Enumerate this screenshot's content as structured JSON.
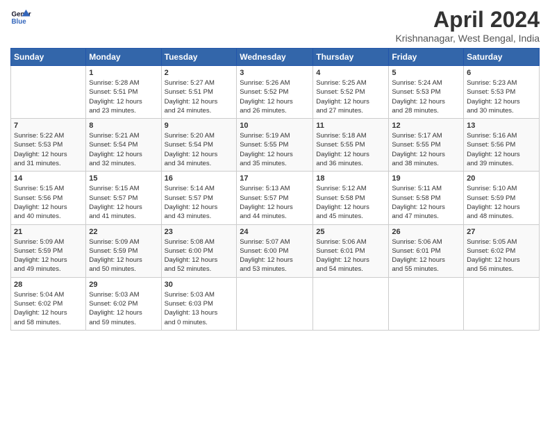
{
  "header": {
    "logo_line1": "General",
    "logo_line2": "Blue",
    "title": "April 2024",
    "location": "Krishnanagar, West Bengal, India"
  },
  "days_of_week": [
    "Sunday",
    "Monday",
    "Tuesday",
    "Wednesday",
    "Thursday",
    "Friday",
    "Saturday"
  ],
  "weeks": [
    [
      {
        "num": "",
        "info": ""
      },
      {
        "num": "1",
        "info": "Sunrise: 5:28 AM\nSunset: 5:51 PM\nDaylight: 12 hours\nand 23 minutes."
      },
      {
        "num": "2",
        "info": "Sunrise: 5:27 AM\nSunset: 5:51 PM\nDaylight: 12 hours\nand 24 minutes."
      },
      {
        "num": "3",
        "info": "Sunrise: 5:26 AM\nSunset: 5:52 PM\nDaylight: 12 hours\nand 26 minutes."
      },
      {
        "num": "4",
        "info": "Sunrise: 5:25 AM\nSunset: 5:52 PM\nDaylight: 12 hours\nand 27 minutes."
      },
      {
        "num": "5",
        "info": "Sunrise: 5:24 AM\nSunset: 5:53 PM\nDaylight: 12 hours\nand 28 minutes."
      },
      {
        "num": "6",
        "info": "Sunrise: 5:23 AM\nSunset: 5:53 PM\nDaylight: 12 hours\nand 30 minutes."
      }
    ],
    [
      {
        "num": "7",
        "info": "Sunrise: 5:22 AM\nSunset: 5:53 PM\nDaylight: 12 hours\nand 31 minutes."
      },
      {
        "num": "8",
        "info": "Sunrise: 5:21 AM\nSunset: 5:54 PM\nDaylight: 12 hours\nand 32 minutes."
      },
      {
        "num": "9",
        "info": "Sunrise: 5:20 AM\nSunset: 5:54 PM\nDaylight: 12 hours\nand 34 minutes."
      },
      {
        "num": "10",
        "info": "Sunrise: 5:19 AM\nSunset: 5:55 PM\nDaylight: 12 hours\nand 35 minutes."
      },
      {
        "num": "11",
        "info": "Sunrise: 5:18 AM\nSunset: 5:55 PM\nDaylight: 12 hours\nand 36 minutes."
      },
      {
        "num": "12",
        "info": "Sunrise: 5:17 AM\nSunset: 5:55 PM\nDaylight: 12 hours\nand 38 minutes."
      },
      {
        "num": "13",
        "info": "Sunrise: 5:16 AM\nSunset: 5:56 PM\nDaylight: 12 hours\nand 39 minutes."
      }
    ],
    [
      {
        "num": "14",
        "info": "Sunrise: 5:15 AM\nSunset: 5:56 PM\nDaylight: 12 hours\nand 40 minutes."
      },
      {
        "num": "15",
        "info": "Sunrise: 5:15 AM\nSunset: 5:57 PM\nDaylight: 12 hours\nand 41 minutes."
      },
      {
        "num": "16",
        "info": "Sunrise: 5:14 AM\nSunset: 5:57 PM\nDaylight: 12 hours\nand 43 minutes."
      },
      {
        "num": "17",
        "info": "Sunrise: 5:13 AM\nSunset: 5:57 PM\nDaylight: 12 hours\nand 44 minutes."
      },
      {
        "num": "18",
        "info": "Sunrise: 5:12 AM\nSunset: 5:58 PM\nDaylight: 12 hours\nand 45 minutes."
      },
      {
        "num": "19",
        "info": "Sunrise: 5:11 AM\nSunset: 5:58 PM\nDaylight: 12 hours\nand 47 minutes."
      },
      {
        "num": "20",
        "info": "Sunrise: 5:10 AM\nSunset: 5:59 PM\nDaylight: 12 hours\nand 48 minutes."
      }
    ],
    [
      {
        "num": "21",
        "info": "Sunrise: 5:09 AM\nSunset: 5:59 PM\nDaylight: 12 hours\nand 49 minutes."
      },
      {
        "num": "22",
        "info": "Sunrise: 5:09 AM\nSunset: 5:59 PM\nDaylight: 12 hours\nand 50 minutes."
      },
      {
        "num": "23",
        "info": "Sunrise: 5:08 AM\nSunset: 6:00 PM\nDaylight: 12 hours\nand 52 minutes."
      },
      {
        "num": "24",
        "info": "Sunrise: 5:07 AM\nSunset: 6:00 PM\nDaylight: 12 hours\nand 53 minutes."
      },
      {
        "num": "25",
        "info": "Sunrise: 5:06 AM\nSunset: 6:01 PM\nDaylight: 12 hours\nand 54 minutes."
      },
      {
        "num": "26",
        "info": "Sunrise: 5:06 AM\nSunset: 6:01 PM\nDaylight: 12 hours\nand 55 minutes."
      },
      {
        "num": "27",
        "info": "Sunrise: 5:05 AM\nSunset: 6:02 PM\nDaylight: 12 hours\nand 56 minutes."
      }
    ],
    [
      {
        "num": "28",
        "info": "Sunrise: 5:04 AM\nSunset: 6:02 PM\nDaylight: 12 hours\nand 58 minutes."
      },
      {
        "num": "29",
        "info": "Sunrise: 5:03 AM\nSunset: 6:02 PM\nDaylight: 12 hours\nand 59 minutes."
      },
      {
        "num": "30",
        "info": "Sunrise: 5:03 AM\nSunset: 6:03 PM\nDaylight: 13 hours\nand 0 minutes."
      },
      {
        "num": "",
        "info": ""
      },
      {
        "num": "",
        "info": ""
      },
      {
        "num": "",
        "info": ""
      },
      {
        "num": "",
        "info": ""
      }
    ]
  ]
}
